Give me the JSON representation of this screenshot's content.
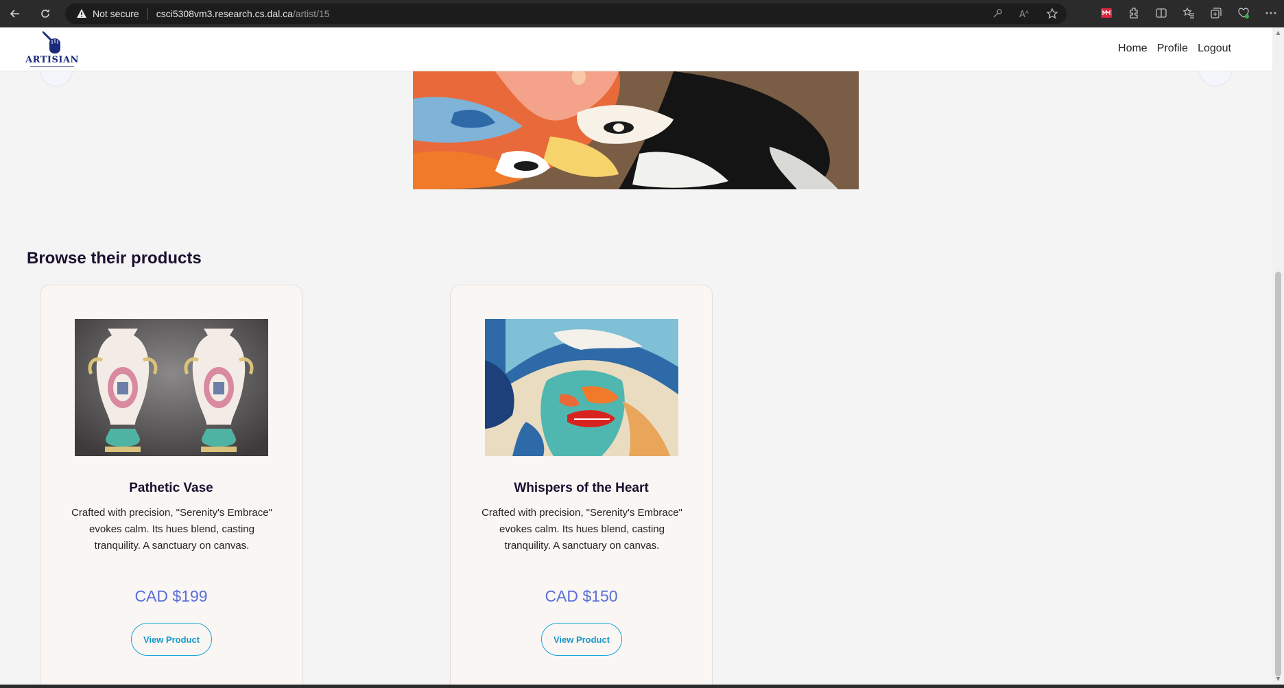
{
  "browser": {
    "security_label": "Not secure",
    "url_host": "csci5308vm3.research.cs.dal.ca",
    "url_path": "/artist/15"
  },
  "nav": {
    "logo_text": "ARTISIAN",
    "links": [
      "Home",
      "Profile",
      "Logout"
    ]
  },
  "section": {
    "title": "Browse their products"
  },
  "products": [
    {
      "name": "Pathetic Vase",
      "description": "Crafted with precision, \"Serenity's Embrace\" evokes calm. Its hues blend, casting tranquility. A sanctuary on canvas.",
      "price": "CAD $199",
      "button": "View Product",
      "image": "porcelain-vases-image"
    },
    {
      "name": "Whispers of the Heart",
      "description": "Crafted with precision, \"Serenity's Embrace\" evokes calm. Its hues blend, casting tranquility. A sanctuary on canvas.",
      "price": "CAD $150",
      "button": "View Product",
      "image": "abstract-face-painting-image"
    }
  ],
  "colors": {
    "accent_price": "#5a6fd6",
    "button_outline": "#19a3d6",
    "brand_navy": "#1b2a7a"
  }
}
